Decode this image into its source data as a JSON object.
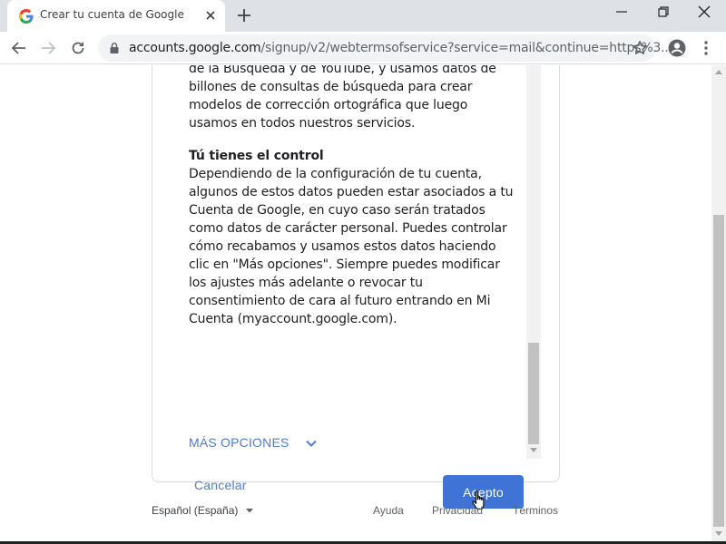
{
  "browser": {
    "tab_title": "Crear tu cuenta de Google",
    "url_host": "accounts.google.com",
    "url_path": "/signup/v2/webtermsofservice?service=mail&continue=https%3..."
  },
  "terms": {
    "paragraph1": "intereses, los cuales se derivan del uso que haces de la Búsqueda y de YouTube, y usamos datos de billones de consultas de búsqueda para crear modelos de corrección ortográfica que luego usamos en todos nuestros servicios.",
    "section_title": "Tú tienes el control",
    "paragraph2": "Dependiendo de la configuración de tu cuenta, algunos de estos datos pueden estar asociados a tu Cuenta de Google, en cuyo caso serán tratados como datos de carácter personal. Puedes controlar cómo recabamos y usamos estos datos haciendo clic en \"Más opciones\". Siempre puedes modificar los ajustes más adelante o revocar tu consentimiento de cara al futuro entrando en Mi Cuenta (myaccount.google.com)."
  },
  "actions": {
    "more_options": "MÁS OPCIONES",
    "cancel": "Cancelar",
    "accept": "Acepto"
  },
  "footer": {
    "language": "Español (España)",
    "help": "Ayuda",
    "privacy": "Privacidad",
    "terms": "Términos"
  },
  "colors": {
    "accent": "#3f74d6",
    "link": "#4d7bd6",
    "tabstrip": "#dee1e6"
  }
}
